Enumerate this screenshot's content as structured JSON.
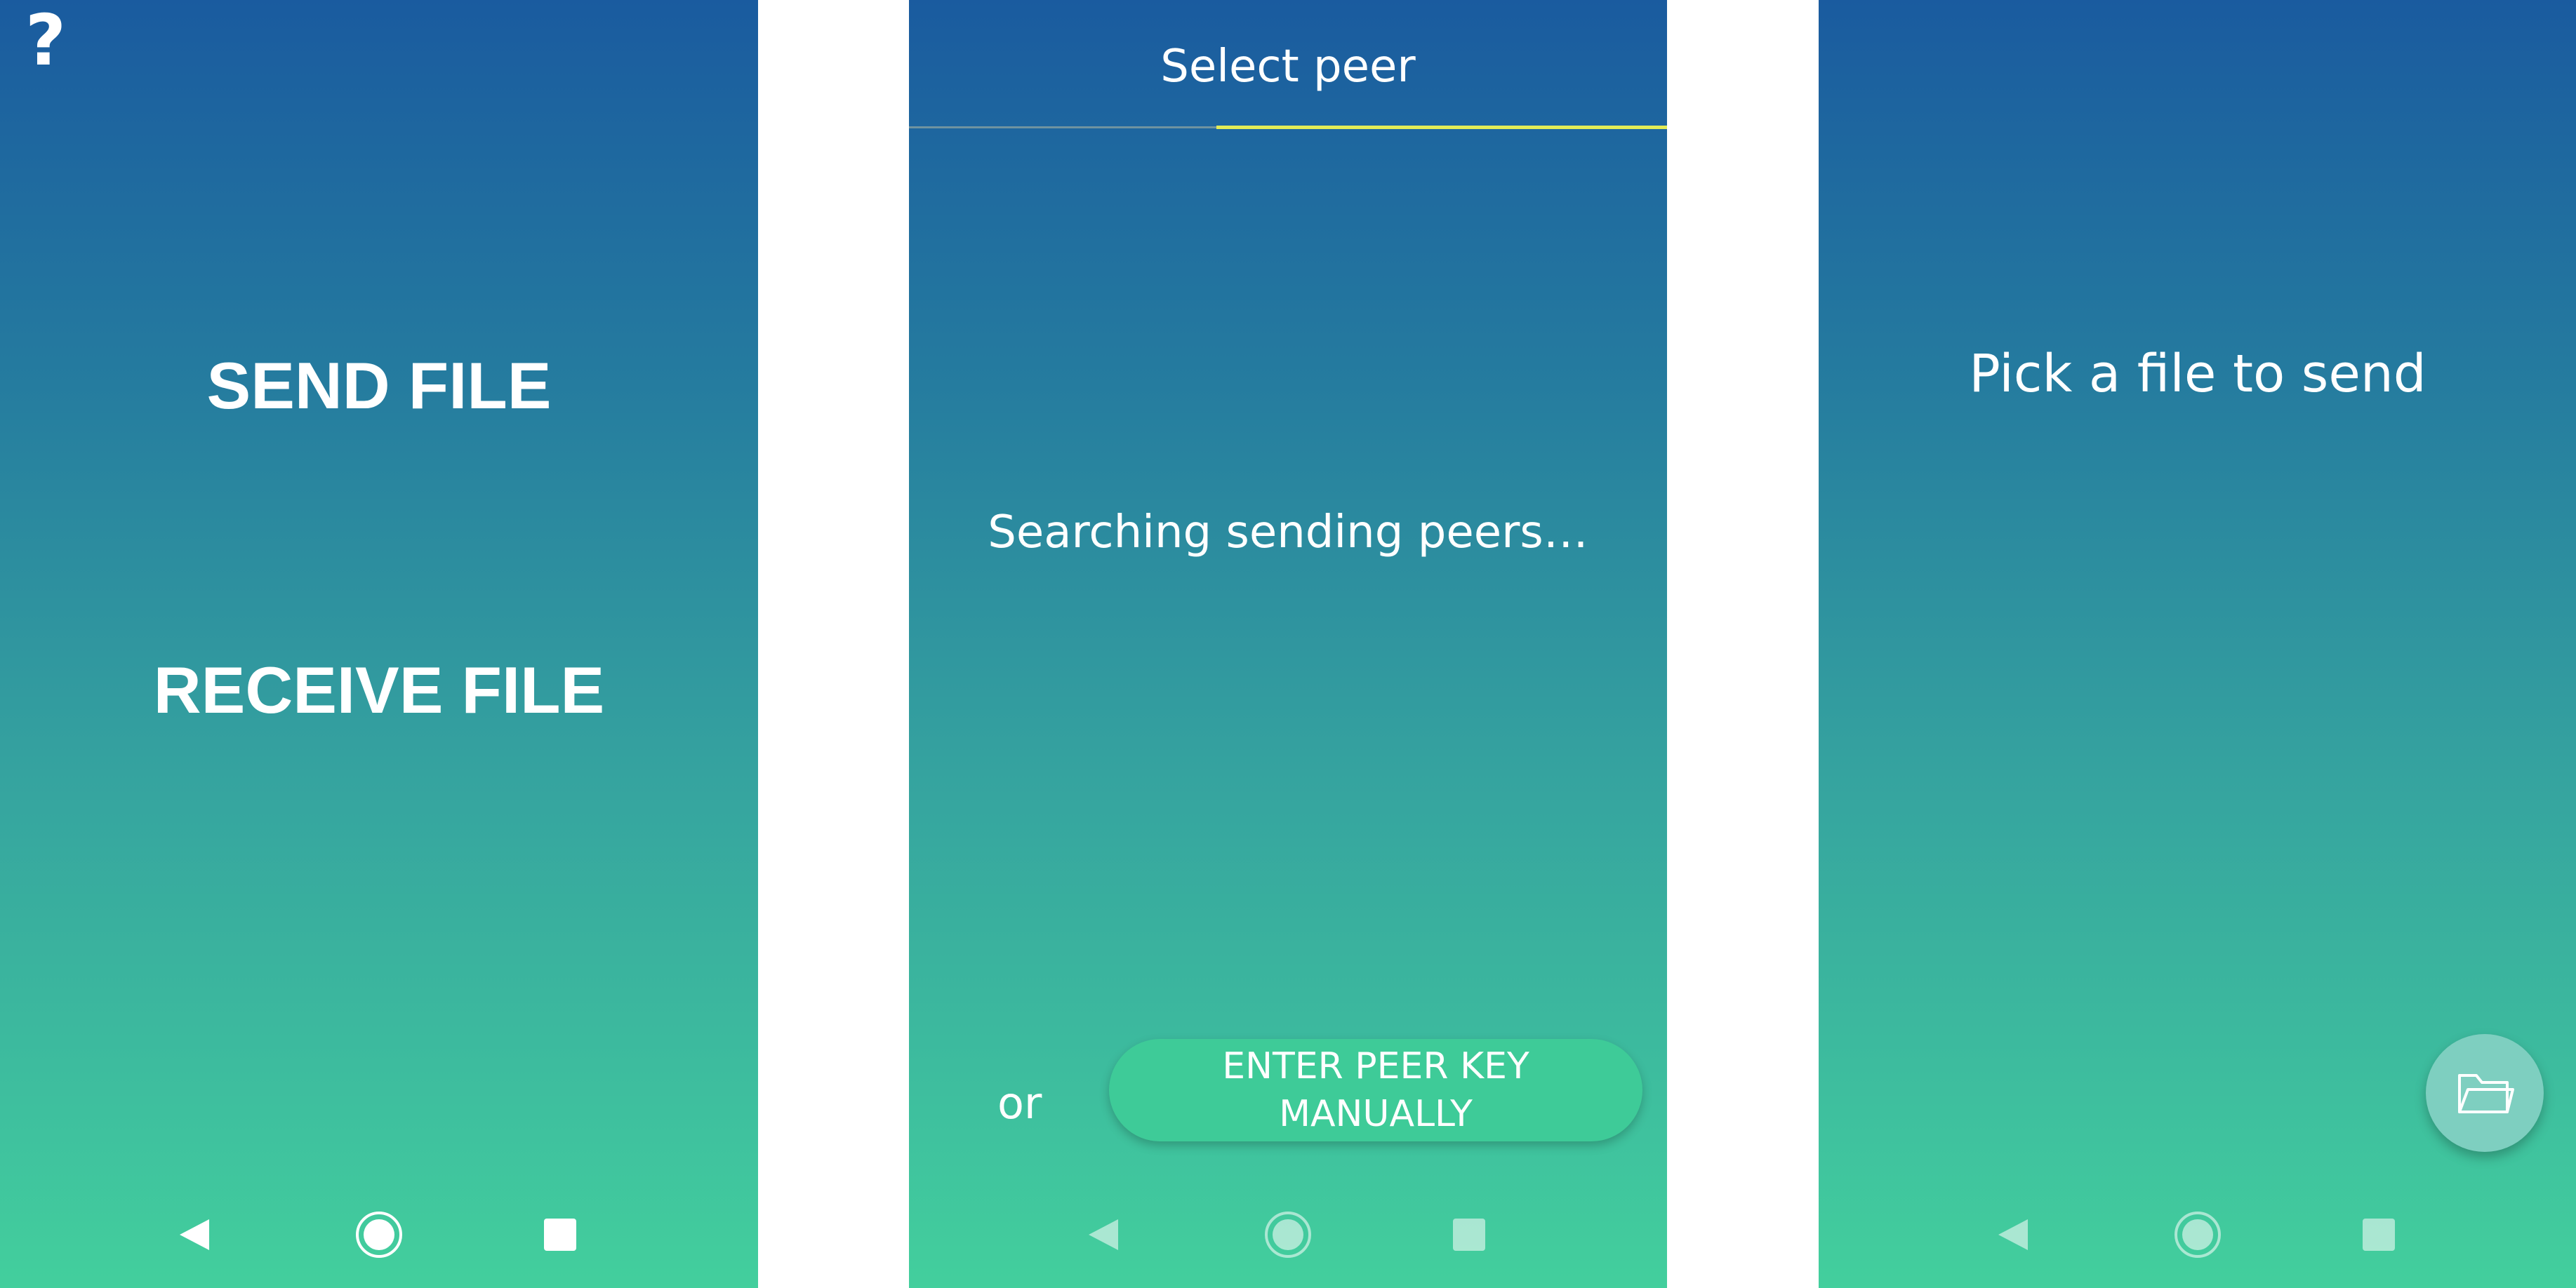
{
  "home": {
    "help_icon": "?",
    "send_file": "SEND FILE",
    "receive_file": "RECEIVE FILE"
  },
  "peer": {
    "title": "Select peer",
    "searching": "Searching sending peers…",
    "or": "or",
    "enter_key_line1": "ENTER PEER KEY",
    "enter_key_line2": "MANUALLY"
  },
  "pick": {
    "title": "Pick a file to send",
    "fab_icon": "folder-open-icon"
  },
  "nav": {
    "icons": [
      "back-icon",
      "home-icon",
      "recent-apps-icon"
    ]
  },
  "colors": {
    "gradient_top": "#1a5b9f",
    "gradient_bottom": "#43cf9d",
    "tab_indicator": "#e3ec56",
    "button_fill": "#3ecb98",
    "fab_fill": "#7ecfc0"
  }
}
